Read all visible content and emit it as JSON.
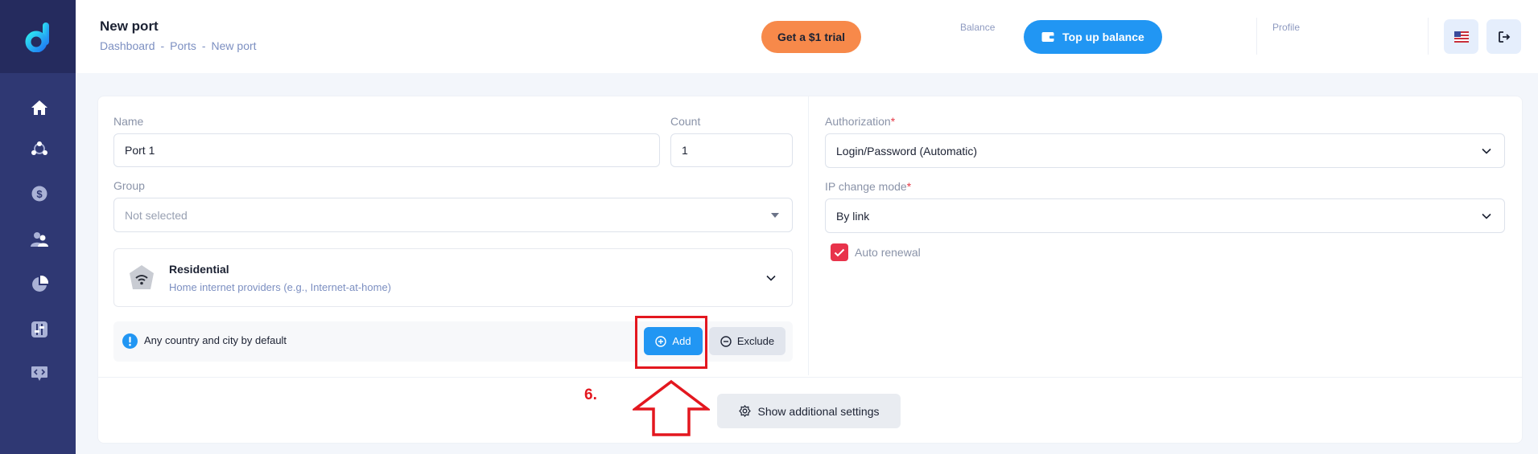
{
  "header": {
    "title": "New port",
    "breadcrumb": [
      "Dashboard",
      "Ports",
      "New port"
    ],
    "breadcrumb_separator": "-",
    "trial_button": "Get a $1 trial",
    "balance_label": "Balance",
    "topup_button": "Top up balance",
    "profile_label": "Profile"
  },
  "sidebar": {
    "items": [
      "home-icon",
      "network-icon",
      "dollar-icon",
      "users-icon",
      "pie-chart-icon",
      "sliders-icon",
      "code-icon"
    ]
  },
  "form": {
    "name": {
      "label": "Name",
      "value": "Port 1"
    },
    "count": {
      "label": "Count",
      "value": "1"
    },
    "group": {
      "label": "Group",
      "placeholder": "Not selected"
    },
    "proxy_type": {
      "title": "Residential",
      "subtitle": "Home internet providers (e.g., Internet-at-home)"
    },
    "geo": {
      "text": "Any country and city by default",
      "add_button": "Add",
      "exclude_button": "Exclude"
    },
    "authorization": {
      "label": "Authorization",
      "required": "*",
      "value": "Login/Password (Automatic)"
    },
    "ip_change_mode": {
      "label": "IP change mode",
      "required": "*",
      "value": "By link"
    },
    "auto_renewal": {
      "label": "Auto renewal",
      "checked": true
    },
    "more_settings_button": "Show additional settings"
  },
  "annotation": {
    "step": "6."
  },
  "colors": {
    "accent": "#2196f3",
    "trial": "#f7894a",
    "sidebar": "#2f3873",
    "annotation": "#e3171f",
    "checkbox": "#e8334b"
  }
}
